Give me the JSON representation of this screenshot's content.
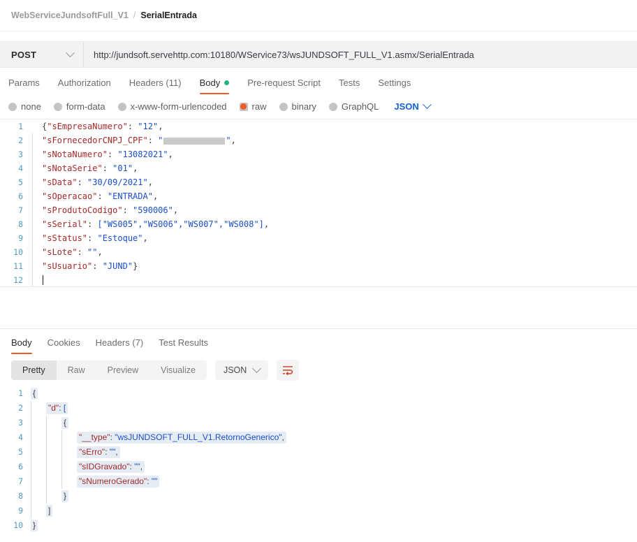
{
  "breadcrumb": {
    "collection": "WebServiceJundsoftFull_V1",
    "separator": "/",
    "request": "SerialEntrada"
  },
  "url_bar": {
    "method": "POST",
    "url": "http://jundsoft.servehttp.com:10180/WService73/wsJUNDSOFT_FULL_V1.asmx/SerialEntrada"
  },
  "request_tabs": [
    {
      "label": "Params",
      "active": false
    },
    {
      "label": "Authorization",
      "active": false
    },
    {
      "label": "Headers (11)",
      "active": false
    },
    {
      "label": "Body",
      "active": true,
      "dot": true
    },
    {
      "label": "Pre-request Script",
      "active": false
    },
    {
      "label": "Tests",
      "active": false
    },
    {
      "label": "Settings",
      "active": false
    }
  ],
  "body_types": [
    {
      "label": "none",
      "selected": false
    },
    {
      "label": "form-data",
      "selected": false
    },
    {
      "label": "x-www-form-urlencoded",
      "selected": false
    },
    {
      "label": "raw",
      "selected": true
    },
    {
      "label": "binary",
      "selected": false
    },
    {
      "label": "GraphQL",
      "selected": false
    }
  ],
  "body_format": "JSON",
  "request_body": {
    "line_numbers": [
      "1",
      "2",
      "3",
      "4",
      "5",
      "6",
      "7",
      "8",
      "9",
      "10",
      "11",
      "12"
    ],
    "lines": [
      {
        "open": "{",
        "key": "\"sEmpresaNumero\"",
        "colon": ": ",
        "value": "\"12\"",
        "comma": ","
      },
      {
        "key": "\"sFornecedorCNPJ_CPF\"",
        "colon": ": ",
        "redacted": true,
        "comma": ","
      },
      {
        "key": "\"sNotaNumero\"",
        "colon": ": ",
        "value": "\"13082021\"",
        "comma": ","
      },
      {
        "key": "\"sNotaSerie\"",
        "colon": ": ",
        "value": "\"01\"",
        "comma": ","
      },
      {
        "key": "\"sData\"",
        "colon": ": ",
        "value": "\"30/09/2021\"",
        "comma": ","
      },
      {
        "key": "\"sOperacao\"",
        "colon": ": ",
        "value": "\"ENTRADA\"",
        "comma": ","
      },
      {
        "key": "\"sProdutoCodigo\"",
        "colon": ": ",
        "value": "\"590006\"",
        "comma": ","
      },
      {
        "key": "\"sSerial\"",
        "colon": ": ",
        "value": "[\"WS005\",\"WS006\",\"WS007\",\"WS008\"]",
        "comma": ","
      },
      {
        "key": "\"sStatus\"",
        "colon": ": ",
        "value": "\"Estoque\"",
        "comma": ","
      },
      {
        "key": "\"sLote\"",
        "colon": ": ",
        "value": "\"\"",
        "comma": ","
      },
      {
        "key": "\"sUsuario\"",
        "colon": ": ",
        "value": "\"JUND\"",
        "comma": "}"
      },
      {
        "cursor": true
      }
    ]
  },
  "response_tabs": [
    {
      "label": "Body",
      "active": true
    },
    {
      "label": "Cookies",
      "active": false
    },
    {
      "label": "Headers (7)",
      "active": false
    },
    {
      "label": "Test Results",
      "active": false
    }
  ],
  "response_toolbar": {
    "views": [
      {
        "label": "Pretty",
        "active": true
      },
      {
        "label": "Raw",
        "active": false
      },
      {
        "label": "Preview",
        "active": false
      },
      {
        "label": "Visualize",
        "active": false
      }
    ],
    "format": "JSON",
    "wrap_icon": "wrap-lines-icon"
  },
  "response_body": {
    "line_numbers": [
      "1",
      "2",
      "3",
      "4",
      "5",
      "6",
      "7",
      "8",
      "9",
      "10"
    ],
    "lines": [
      {
        "indent": 0,
        "text": "{",
        "type": "brace"
      },
      {
        "indent": 1,
        "key": "\"d\"",
        "colon": ": ",
        "value": "[",
        "type": "openarr"
      },
      {
        "indent": 2,
        "text": "{",
        "type": "brace"
      },
      {
        "indent": 3,
        "key": "\"__type\"",
        "colon": ": ",
        "value": "\"wsJUNDSOFT_FULL_V1.RetornoGenerico\"",
        "comma": ","
      },
      {
        "indent": 3,
        "key": "\"sErro\"",
        "colon": ": ",
        "value": "\"\"",
        "comma": ","
      },
      {
        "indent": 3,
        "key": "\"sIDGravado\"",
        "colon": ": ",
        "value": "\"\"",
        "comma": ","
      },
      {
        "indent": 3,
        "key": "\"sNumeroGerado\"",
        "colon": ": ",
        "value": "\"\"",
        "comma": ""
      },
      {
        "indent": 2,
        "text": "}",
        "type": "brace"
      },
      {
        "indent": 1,
        "text": "]",
        "type": "brace"
      },
      {
        "indent": 0,
        "text": "}",
        "type": "brace"
      }
    ]
  },
  "colors": {
    "accent_orange": "#ef5b25",
    "link_blue": "#1063d4",
    "json_key": "#a22a2a",
    "json_string": "#1a4fcb",
    "gutter_blue": "#4f9bbd",
    "status_green": "#23b47e",
    "selection": "#e6ecf3"
  }
}
